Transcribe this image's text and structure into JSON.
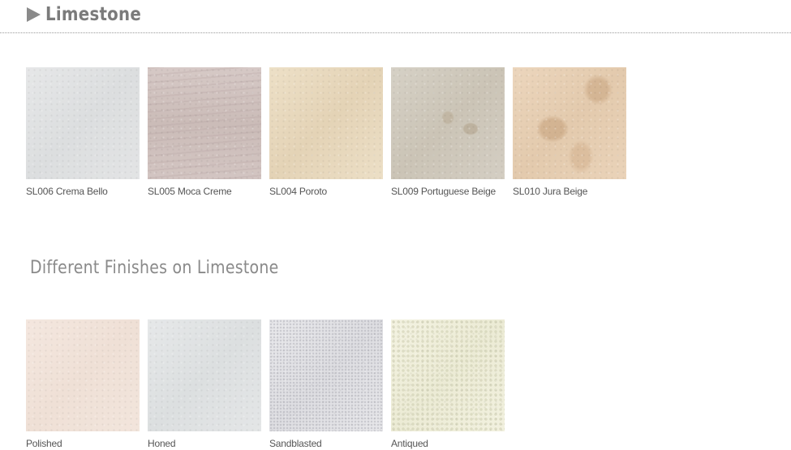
{
  "header": {
    "title": "Limestone",
    "icon": "arrow-right-icon"
  },
  "stones": [
    {
      "label": "SL006 Crema Bello",
      "texture": "sw-crema"
    },
    {
      "label": "SL005 Moca Creme",
      "texture": "sw-moca"
    },
    {
      "label": "SL004 Poroto",
      "texture": "sw-poroto"
    },
    {
      "label": "SL009 Portuguese Beige",
      "texture": "sw-portuguese"
    },
    {
      "label": "SL010 Jura Beige",
      "texture": "sw-jura"
    }
  ],
  "finishes_section": {
    "title": "Different Finishes on Limestone"
  },
  "finishes": [
    {
      "label": "Polished",
      "texture": "sw-polished"
    },
    {
      "label": "Honed",
      "texture": "sw-honed"
    },
    {
      "label": "Sandblasted",
      "texture": "sw-sandblasted"
    },
    {
      "label": "Antiqued",
      "texture": "sw-antiqued"
    }
  ],
  "colors": {
    "title": "#7b7b7b",
    "caption": "#555555",
    "divider": "#9a9a9a"
  }
}
